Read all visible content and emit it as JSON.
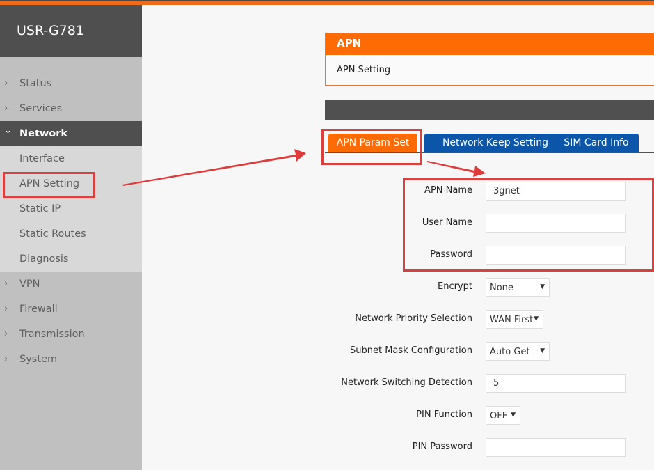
{
  "brand": {
    "title": "USR-G781"
  },
  "sidebar": {
    "items": [
      {
        "label": "Status",
        "icon": "chevron-right-icon"
      },
      {
        "label": "Services",
        "icon": "chevron-right-icon"
      },
      {
        "label": "Network",
        "icon": "chevron-down-icon",
        "active": true,
        "children": [
          {
            "label": "Interface"
          },
          {
            "label": "APN Setting",
            "highlighted": true
          },
          {
            "label": "Static IP"
          },
          {
            "label": "Static Routes"
          },
          {
            "label": "Diagnosis"
          }
        ]
      },
      {
        "label": "VPN",
        "icon": "chevron-right-icon"
      },
      {
        "label": "Firewall",
        "icon": "chevron-right-icon"
      },
      {
        "label": "Transmission",
        "icon": "chevron-right-icon"
      },
      {
        "label": "System",
        "icon": "chevron-right-icon"
      }
    ]
  },
  "panel": {
    "title": "APN",
    "subtitle": "APN Setting"
  },
  "tabs": [
    {
      "label": "APN Param Set",
      "active": true
    },
    {
      "label": "Network Keep Setting"
    },
    {
      "label": "SIM Card Info"
    }
  ],
  "form": {
    "apn_name": {
      "label": "APN Name",
      "value": "3gnet"
    },
    "user_name": {
      "label": "User Name",
      "value": ""
    },
    "password": {
      "label": "Password",
      "value": ""
    },
    "encrypt": {
      "label": "Encrypt",
      "value": "None"
    },
    "network_priority": {
      "label": "Network Priority Selection",
      "value": "WAN First"
    },
    "subnet_mask": {
      "label": "Subnet Mask Configuration",
      "value": "Auto Get"
    },
    "switch_detection": {
      "label": "Network Switching Detection",
      "value": "5"
    },
    "pin_function": {
      "label": "PIN Function",
      "value": "OFF"
    },
    "pin_password": {
      "label": "PIN Password",
      "value": ""
    }
  },
  "colors": {
    "accent_orange": "#fe6a03",
    "tab_blue": "#0b56a8",
    "dark_gray": "#4f4f4f",
    "annotation_red": "#d9413f"
  },
  "glyphs": {
    "chev_right": "›",
    "chev_down": "⌄",
    "dropdown": "▼"
  }
}
